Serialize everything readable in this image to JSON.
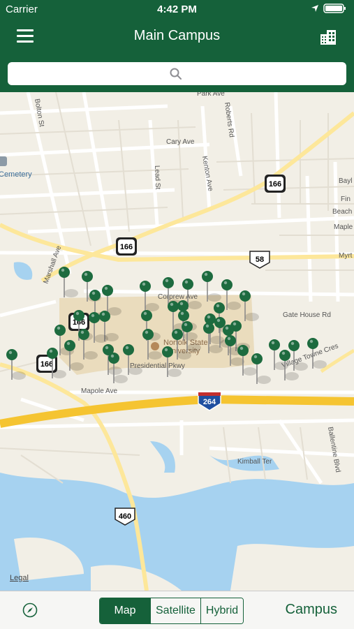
{
  "status": {
    "carrier": "Carrier",
    "time": "4:42 PM"
  },
  "nav": {
    "title": "Main Campus",
    "menu_icon": "hamburger-icon",
    "right_icon": "building-icon"
  },
  "search": {
    "placeholder": "",
    "icon": "search-icon"
  },
  "map": {
    "streets": [
      "Bolton St",
      "Marshall Ave",
      "Lead St",
      "Kenton Ave",
      "Roberts Rd",
      "Cary Ave",
      "Corprew Ave",
      "Gate House Rd",
      "Presidential Pkwy",
      "Mapole Ave",
      "Kimball Ter",
      "Ballentine Blvd",
      "Park Ave",
      "Beach",
      "Maple",
      "Myrt",
      "Bayl",
      "Fin",
      "Village Towne Cres",
      "Cemetery"
    ],
    "poi": [
      "Norfolk State",
      "University"
    ],
    "shields": [
      "166",
      "166",
      "166",
      "166",
      "58",
      "264",
      "460"
    ],
    "legal": "Legal"
  },
  "toolbar": {
    "compass_icon": "compass-icon",
    "segments": [
      "Map",
      "Satellite",
      "Hybrid"
    ],
    "selected": "Map",
    "campus_label": "Campus"
  },
  "colors": {
    "brand": "#15613a",
    "pin": "#1d6b3f",
    "water": "#a6d2f0",
    "highway": "#f5c431",
    "campus": "#e7d7b3"
  }
}
